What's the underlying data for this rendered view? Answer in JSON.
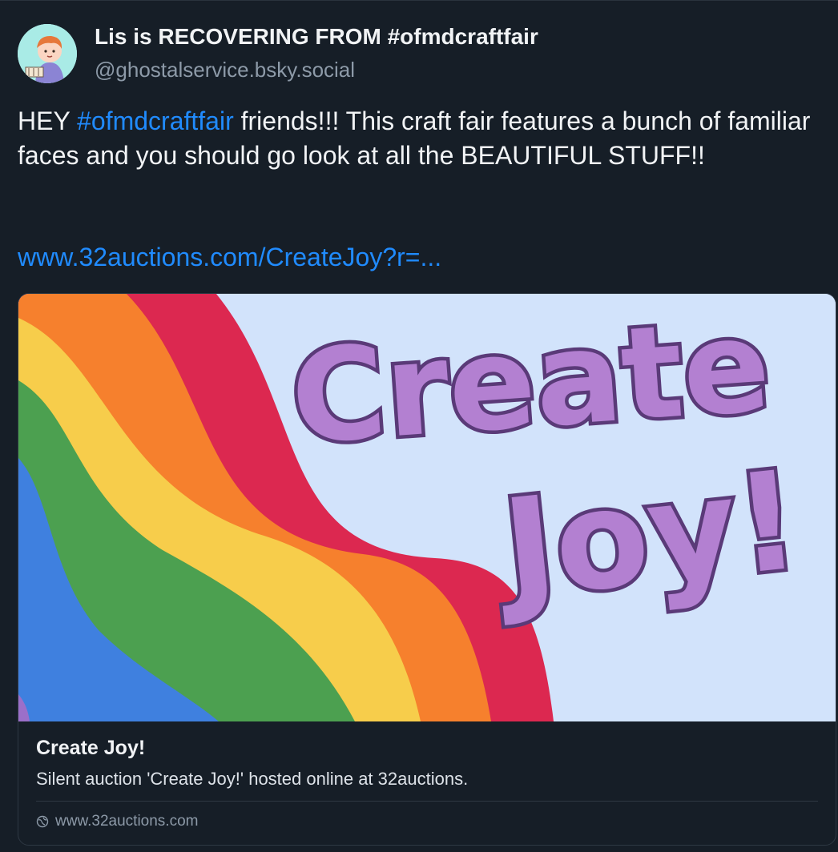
{
  "author": {
    "display_name": "Lis is RECOVERING FROM #ofmdcraftfair",
    "handle": "@ghostalservice.bsky.social",
    "avatar_icon": "cartoon-character-avatar"
  },
  "post": {
    "text_before": "HEY ",
    "hashtag": "#ofmdcraftfair",
    "text_after": " friends!!! This craft fair features a bunch of familiar faces and you should go look at all the BEAUTIFUL STUFF!!",
    "link": "www.32auctions.com/CreateJoy?r=..."
  },
  "link_card": {
    "image_text_line1": "Create",
    "image_text_line2": "Joy!",
    "title": "Create Joy!",
    "description": "Silent auction 'Create Joy!' hosted online at 32auctions.",
    "domain": "www.32auctions.com",
    "domain_icon": "globe-icon"
  },
  "colors": {
    "background": "#161e27",
    "link": "#208bfe",
    "muted": "#8d9aa8",
    "rainbow": [
      "#dc2850",
      "#f6802d",
      "#f7cd4b",
      "#4ca050",
      "#3f80df",
      "#9b6fc9"
    ],
    "image_background": "#d2e3fb",
    "lettering_fill": "#b380d1",
    "lettering_outline": "#5a3a78"
  }
}
